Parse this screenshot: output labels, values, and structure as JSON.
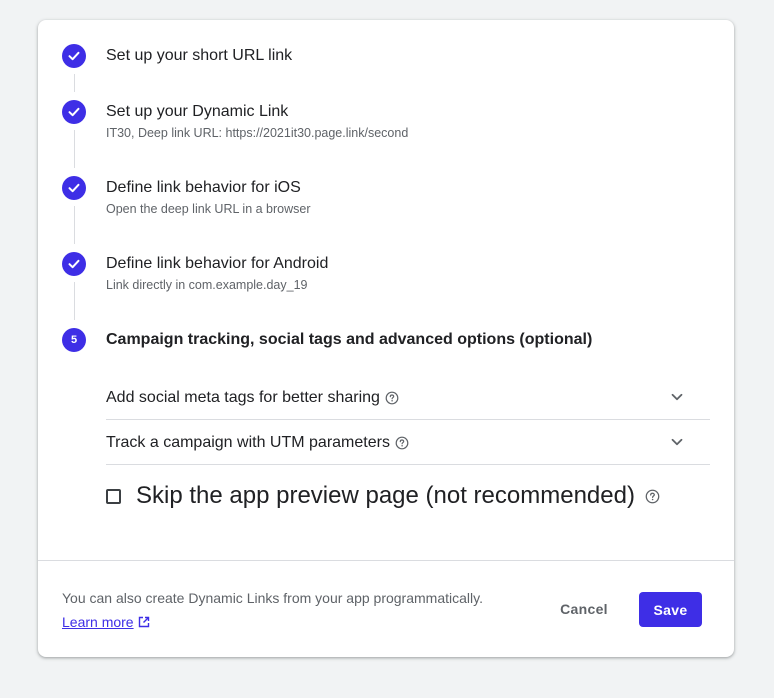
{
  "steps": [
    {
      "title": "Set up your short URL link",
      "subtitle": "",
      "status": "done"
    },
    {
      "title": "Set up your Dynamic Link",
      "subtitle": "IT30, Deep link URL: https://2021it30.page.link/second",
      "status": "done"
    },
    {
      "title": "Define link behavior for iOS",
      "subtitle": "Open the deep link URL in a browser",
      "status": "done"
    },
    {
      "title": "Define link behavior for Android",
      "subtitle": "Link directly in com.example.day_19",
      "status": "done"
    },
    {
      "number": "5",
      "title": "Campaign tracking, social tags and advanced options (optional)",
      "status": "active"
    }
  ],
  "options": {
    "social_meta_label": "Add social meta tags for better sharing",
    "utm_label": "Track a campaign with UTM parameters",
    "skip_preview_label": "Skip the app preview page (not recommended)",
    "skip_preview_checked": false
  },
  "footer": {
    "info_text": "You can also create Dynamic Links from your app programmatically.",
    "learn_more": "Learn more",
    "cancel_label": "Cancel",
    "save_label": "Save"
  },
  "colors": {
    "accent": "#3e2ee6",
    "background": "#f1f3f4",
    "card": "#ffffff",
    "divider": "#dadce0",
    "secondary_text": "#5f6368"
  },
  "icons": [
    "check-icon",
    "help-icon",
    "chevron-down-icon",
    "open-in-new-icon"
  ]
}
